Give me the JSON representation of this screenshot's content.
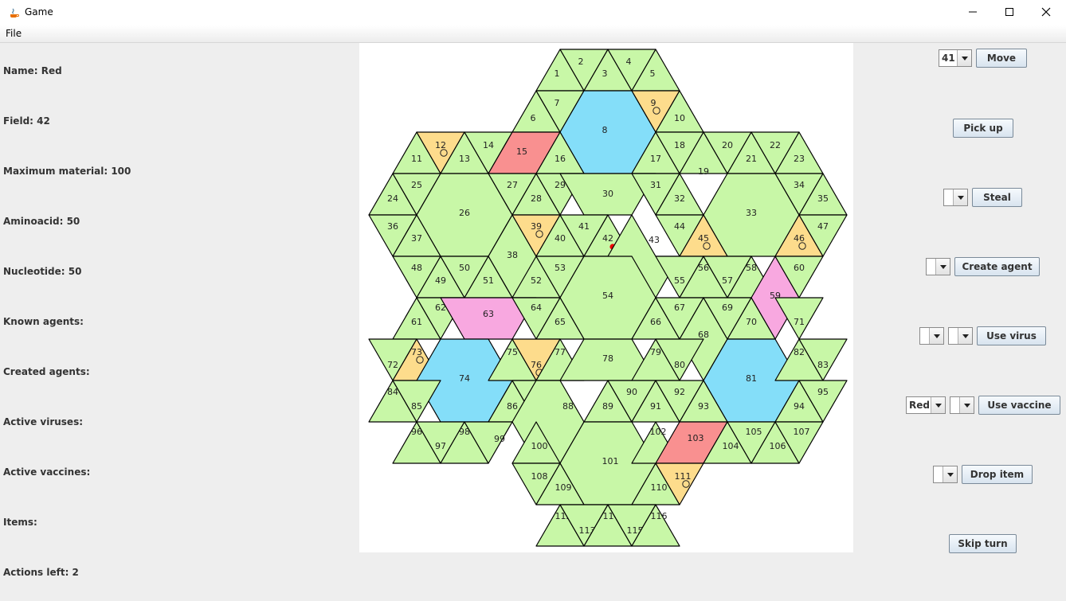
{
  "window": {
    "title": "Game"
  },
  "menu": {
    "file": "File"
  },
  "info": {
    "name": "Name: Red",
    "field": "Field: 42",
    "max_material": "Maximum material: 100",
    "aminoacid": "Aminoacid: 50",
    "nucleotide": "Nucleotide: 50",
    "known_agents": "Known agents:",
    "created_agents": "Created agents:",
    "active_viruses": "Active viruses:",
    "active_vaccines": "Active vaccines:",
    "items": "Items:",
    "actions_left": "Actions left: 2"
  },
  "controls": {
    "move_combo": "41",
    "move": "Move",
    "pick_up": "Pick up",
    "steal_combo": "",
    "steal": "Steal",
    "create_agent_combo": "",
    "create_agent": "Create agent",
    "virus_combo_1": "",
    "virus_combo_2": "",
    "use_virus": "Use virus",
    "vaccine_combo_1": "Red",
    "vaccine_combo_2": "",
    "use_vaccine": "Use vaccine",
    "drop_item_combo": "",
    "drop_item": "Drop item",
    "skip_turn": "Skip turn"
  },
  "board": {
    "colors": {
      "normal": "#c8f7a7",
      "warehouse": "#fddc8c",
      "lab": "#f99090",
      "shelter": "#f8a8e0",
      "special": "#84def9"
    },
    "fields": [
      {
        "id": "1",
        "kind": "normal"
      },
      {
        "id": "2",
        "kind": "normal"
      },
      {
        "id": "3",
        "kind": "normal"
      },
      {
        "id": "4",
        "kind": "normal"
      },
      {
        "id": "5",
        "kind": "normal"
      },
      {
        "id": "6",
        "kind": "normal"
      },
      {
        "id": "7",
        "kind": "normal"
      },
      {
        "id": "8",
        "kind": "special"
      },
      {
        "id": "9",
        "kind": "warehouse",
        "item": true
      },
      {
        "id": "10",
        "kind": "normal"
      },
      {
        "id": "11",
        "kind": "normal"
      },
      {
        "id": "12",
        "kind": "warehouse",
        "item": true
      },
      {
        "id": "13",
        "kind": "normal"
      },
      {
        "id": "14",
        "kind": "normal"
      },
      {
        "id": "15",
        "kind": "lab"
      },
      {
        "id": "16",
        "kind": "normal"
      },
      {
        "id": "17",
        "kind": "normal"
      },
      {
        "id": "18",
        "kind": "normal"
      },
      {
        "id": "19",
        "kind": "normal"
      },
      {
        "id": "20",
        "kind": "normal"
      },
      {
        "id": "21",
        "kind": "normal"
      },
      {
        "id": "22",
        "kind": "normal"
      },
      {
        "id": "23",
        "kind": "normal"
      },
      {
        "id": "24",
        "kind": "normal"
      },
      {
        "id": "25",
        "kind": "normal"
      },
      {
        "id": "26",
        "kind": "normal"
      },
      {
        "id": "27",
        "kind": "normal"
      },
      {
        "id": "28",
        "kind": "normal"
      },
      {
        "id": "29",
        "kind": "normal"
      },
      {
        "id": "30",
        "kind": "normal"
      },
      {
        "id": "31",
        "kind": "normal"
      },
      {
        "id": "32",
        "kind": "normal"
      },
      {
        "id": "33",
        "kind": "normal"
      },
      {
        "id": "34",
        "kind": "normal"
      },
      {
        "id": "35",
        "kind": "normal"
      },
      {
        "id": "36",
        "kind": "normal"
      },
      {
        "id": "37",
        "kind": "normal"
      },
      {
        "id": "38",
        "kind": "normal"
      },
      {
        "id": "39",
        "kind": "warehouse",
        "item": true
      },
      {
        "id": "40",
        "kind": "normal"
      },
      {
        "id": "41",
        "kind": "normal"
      },
      {
        "id": "42",
        "kind": "normal",
        "player": true
      },
      {
        "id": "43",
        "kind": "normal"
      },
      {
        "id": "44",
        "kind": "normal"
      },
      {
        "id": "45",
        "kind": "warehouse",
        "item": true
      },
      {
        "id": "46",
        "kind": "warehouse",
        "item": true
      },
      {
        "id": "47",
        "kind": "normal"
      },
      {
        "id": "48",
        "kind": "normal"
      },
      {
        "id": "49",
        "kind": "normal"
      },
      {
        "id": "50",
        "kind": "normal"
      },
      {
        "id": "51",
        "kind": "normal"
      },
      {
        "id": "52",
        "kind": "normal"
      },
      {
        "id": "53",
        "kind": "normal"
      },
      {
        "id": "54",
        "kind": "normal"
      },
      {
        "id": "55",
        "kind": "normal"
      },
      {
        "id": "56",
        "kind": "normal"
      },
      {
        "id": "57",
        "kind": "normal"
      },
      {
        "id": "58",
        "kind": "normal"
      },
      {
        "id": "59",
        "kind": "shelter"
      },
      {
        "id": "60",
        "kind": "normal"
      },
      {
        "id": "61",
        "kind": "normal"
      },
      {
        "id": "62",
        "kind": "normal"
      },
      {
        "id": "63",
        "kind": "shelter"
      },
      {
        "id": "64",
        "kind": "normal"
      },
      {
        "id": "65",
        "kind": "normal"
      },
      {
        "id": "66",
        "kind": "normal"
      },
      {
        "id": "67",
        "kind": "normal"
      },
      {
        "id": "68",
        "kind": "normal"
      },
      {
        "id": "69",
        "kind": "normal"
      },
      {
        "id": "70",
        "kind": "normal"
      },
      {
        "id": "71",
        "kind": "normal"
      },
      {
        "id": "72",
        "kind": "normal"
      },
      {
        "id": "73",
        "kind": "warehouse",
        "item": true
      },
      {
        "id": "74",
        "kind": "special"
      },
      {
        "id": "75",
        "kind": "normal"
      },
      {
        "id": "76",
        "kind": "warehouse",
        "item": true
      },
      {
        "id": "77",
        "kind": "normal"
      },
      {
        "id": "78",
        "kind": "normal"
      },
      {
        "id": "79",
        "kind": "normal"
      },
      {
        "id": "80",
        "kind": "normal"
      },
      {
        "id": "81",
        "kind": "special"
      },
      {
        "id": "82",
        "kind": "normal"
      },
      {
        "id": "83",
        "kind": "normal"
      },
      {
        "id": "84",
        "kind": "normal"
      },
      {
        "id": "85",
        "kind": "normal"
      },
      {
        "id": "86",
        "kind": "normal"
      },
      {
        "id": "87",
        "kind": "normal"
      },
      {
        "id": "88",
        "kind": "normal"
      },
      {
        "id": "89",
        "kind": "normal"
      },
      {
        "id": "90",
        "kind": "normal"
      },
      {
        "id": "91",
        "kind": "normal"
      },
      {
        "id": "92",
        "kind": "normal"
      },
      {
        "id": "93",
        "kind": "normal"
      },
      {
        "id": "94",
        "kind": "normal"
      },
      {
        "id": "95",
        "kind": "normal"
      },
      {
        "id": "96",
        "kind": "normal"
      },
      {
        "id": "97",
        "kind": "normal"
      },
      {
        "id": "98",
        "kind": "normal"
      },
      {
        "id": "99",
        "kind": "normal"
      },
      {
        "id": "100",
        "kind": "normal"
      },
      {
        "id": "101",
        "kind": "normal"
      },
      {
        "id": "102",
        "kind": "normal"
      },
      {
        "id": "103",
        "kind": "lab"
      },
      {
        "id": "104",
        "kind": "normal"
      },
      {
        "id": "105",
        "kind": "normal"
      },
      {
        "id": "106",
        "kind": "normal"
      },
      {
        "id": "107",
        "kind": "normal"
      },
      {
        "id": "108",
        "kind": "normal"
      },
      {
        "id": "109",
        "kind": "normal"
      },
      {
        "id": "110",
        "kind": "normal"
      },
      {
        "id": "111",
        "kind": "warehouse",
        "item": true
      },
      {
        "id": "112",
        "kind": "normal"
      },
      {
        "id": "113",
        "kind": "normal"
      },
      {
        "id": "114",
        "kind": "normal"
      },
      {
        "id": "115",
        "kind": "normal"
      },
      {
        "id": "116",
        "kind": "normal"
      }
    ]
  }
}
